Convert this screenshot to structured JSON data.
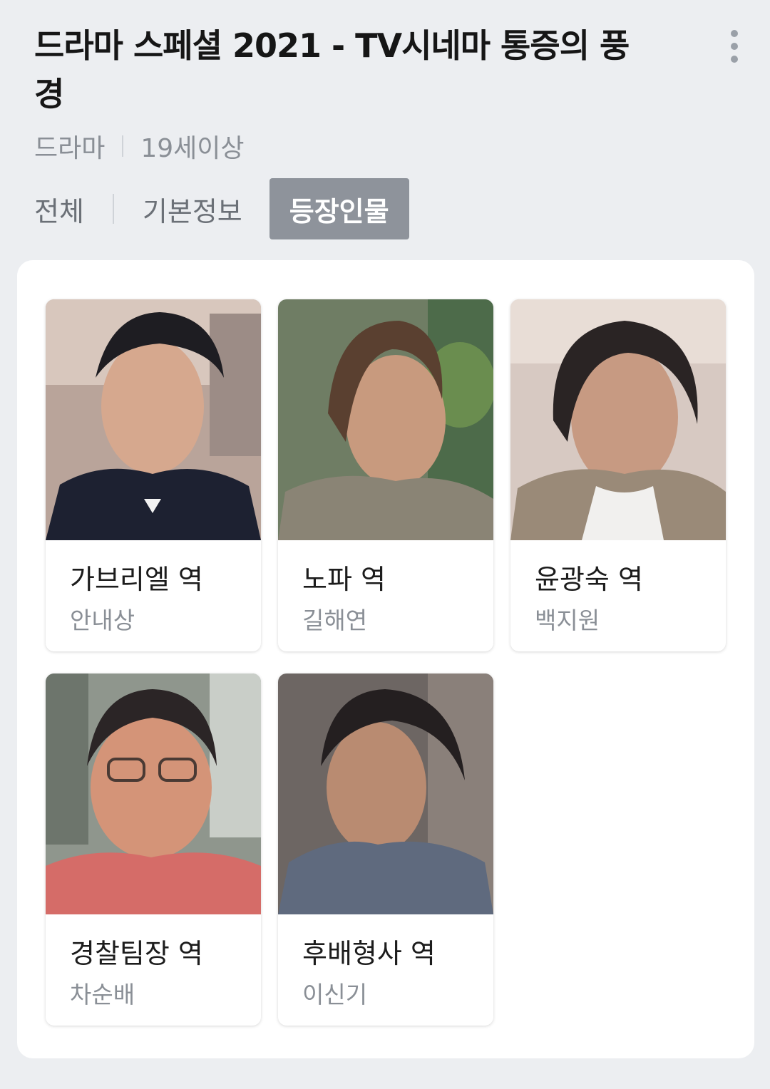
{
  "header": {
    "title": "드라마 스페셜 2021 - TV시네마 통증의 풍경",
    "meta": [
      "드라마",
      "19세이상"
    ]
  },
  "tabs": [
    {
      "label": "전체",
      "active": false
    },
    {
      "label": "기본정보",
      "active": false
    },
    {
      "label": "등장인물",
      "active": true
    }
  ],
  "cast": [
    {
      "role": "가브리엘 역",
      "actor": "안내상"
    },
    {
      "role": "노파 역",
      "actor": "길해연"
    },
    {
      "role": "윤광숙 역",
      "actor": "백지원"
    },
    {
      "role": "경찰팀장 역",
      "actor": "차순배"
    },
    {
      "role": "후배형사 역",
      "actor": "이신기"
    }
  ],
  "colors": {
    "background": "#eceef1",
    "active_tab": "#8e939b",
    "muted_text": "#8a8f96"
  }
}
